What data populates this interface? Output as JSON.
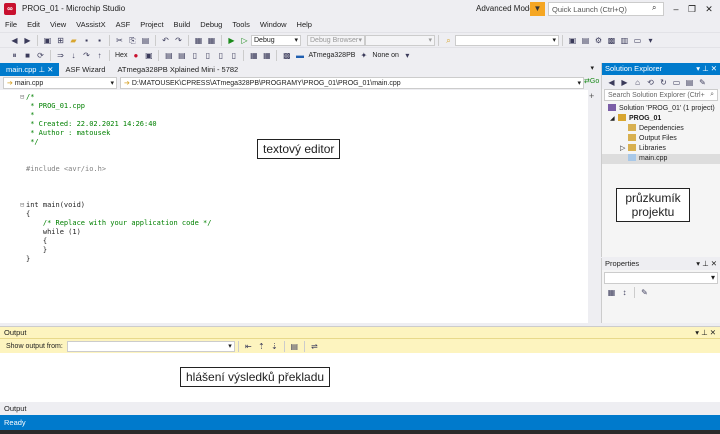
{
  "window": {
    "title": "PROG_01 - Microchip Studio",
    "app_icon_glyph": "∞",
    "advanced_mode": "Advanced Mode",
    "quick_launch_placeholder": "Quick Launch (Ctrl+Q)"
  },
  "menu": [
    "File",
    "Edit",
    "View",
    "VAssistX",
    "ASF",
    "Project",
    "Build",
    "Debug",
    "Tools",
    "Window",
    "Help"
  ],
  "toolbar1": {
    "config": "Debug",
    "platform": "Debug Browser",
    "platform_disabled": true
  },
  "toolbar2": {
    "hex_label": "Hex",
    "device": "ATmega328PB",
    "tool": "None on"
  },
  "doc_tabs": [
    {
      "label": "main.cpp",
      "active": true
    },
    {
      "label": "ASF Wizard",
      "active": false
    },
    {
      "label": "ATmega328PB Xplained Mini - 5782",
      "active": false
    }
  ],
  "nav": {
    "scope": "main.cpp",
    "path": "D:\\MATOUSEK\\CPRESS\\ATmega328PB\\PROGRAMY\\PROG_01\\PROG_01\\main.cpp",
    "go_label": "Go"
  },
  "code_lines": [
    {
      "text": "/*",
      "cls": "cm"
    },
    {
      "text": " * PROG_01.cpp",
      "cls": "cm"
    },
    {
      "text": " *",
      "cls": "cm"
    },
    {
      "text": " * Created: 22.02.2021 14:26:40",
      "cls": "cm"
    },
    {
      "text": " * Author : matousek",
      "cls": "cm"
    },
    {
      "text": " */",
      "cls": "cm"
    },
    {
      "text": "",
      "cls": ""
    },
    {
      "text": "",
      "cls": ""
    },
    {
      "text": "#include <avr/io.h>",
      "cls": "inc"
    },
    {
      "text": "",
      "cls": ""
    },
    {
      "text": "",
      "cls": ""
    },
    {
      "text": "",
      "cls": ""
    },
    {
      "text": "int main(void)",
      "cls": "fn"
    },
    {
      "text": "{",
      "cls": ""
    },
    {
      "text": "    /* Replace with your application code */",
      "cls": "cm"
    },
    {
      "text": "    while (1)",
      "cls": "fn"
    },
    {
      "text": "    {",
      "cls": ""
    },
    {
      "text": "    }",
      "cls": ""
    },
    {
      "text": "}",
      "cls": ""
    }
  ],
  "callouts": {
    "editor": "textový editor",
    "explorer_line1": "průzkumík",
    "explorer_line2": "projektu",
    "output": "hlášení výsledků překladu"
  },
  "solution_explorer": {
    "title": "Solution Explorer",
    "search_placeholder": "Search Solution Explorer (Ctrl+",
    "tree": [
      {
        "label": "Solution 'PROG_01' (1 project)",
        "indent": 0,
        "icon": "solution",
        "bold": false,
        "selected": false
      },
      {
        "label": "PROG_01",
        "indent": 1,
        "icon": "project",
        "bold": true,
        "selected": false
      },
      {
        "label": "Dependencies",
        "indent": 2,
        "icon": "folder",
        "bold": false,
        "selected": false
      },
      {
        "label": "Output Files",
        "indent": 2,
        "icon": "folder",
        "bold": false,
        "selected": false
      },
      {
        "label": "Libraries",
        "indent": 2,
        "icon": "folder",
        "bold": false,
        "selected": false
      },
      {
        "label": "main.cpp",
        "indent": 2,
        "icon": "file",
        "bold": false,
        "selected": true
      }
    ]
  },
  "properties": {
    "title": "Properties"
  },
  "output": {
    "title": "Output",
    "show_from_label": "Show output from:",
    "tab_label": "Output"
  },
  "status": {
    "text": "Ready"
  },
  "colors": {
    "accent": "#007acc",
    "output_header": "#fdf4bf",
    "app_icon": "#c8102e"
  }
}
